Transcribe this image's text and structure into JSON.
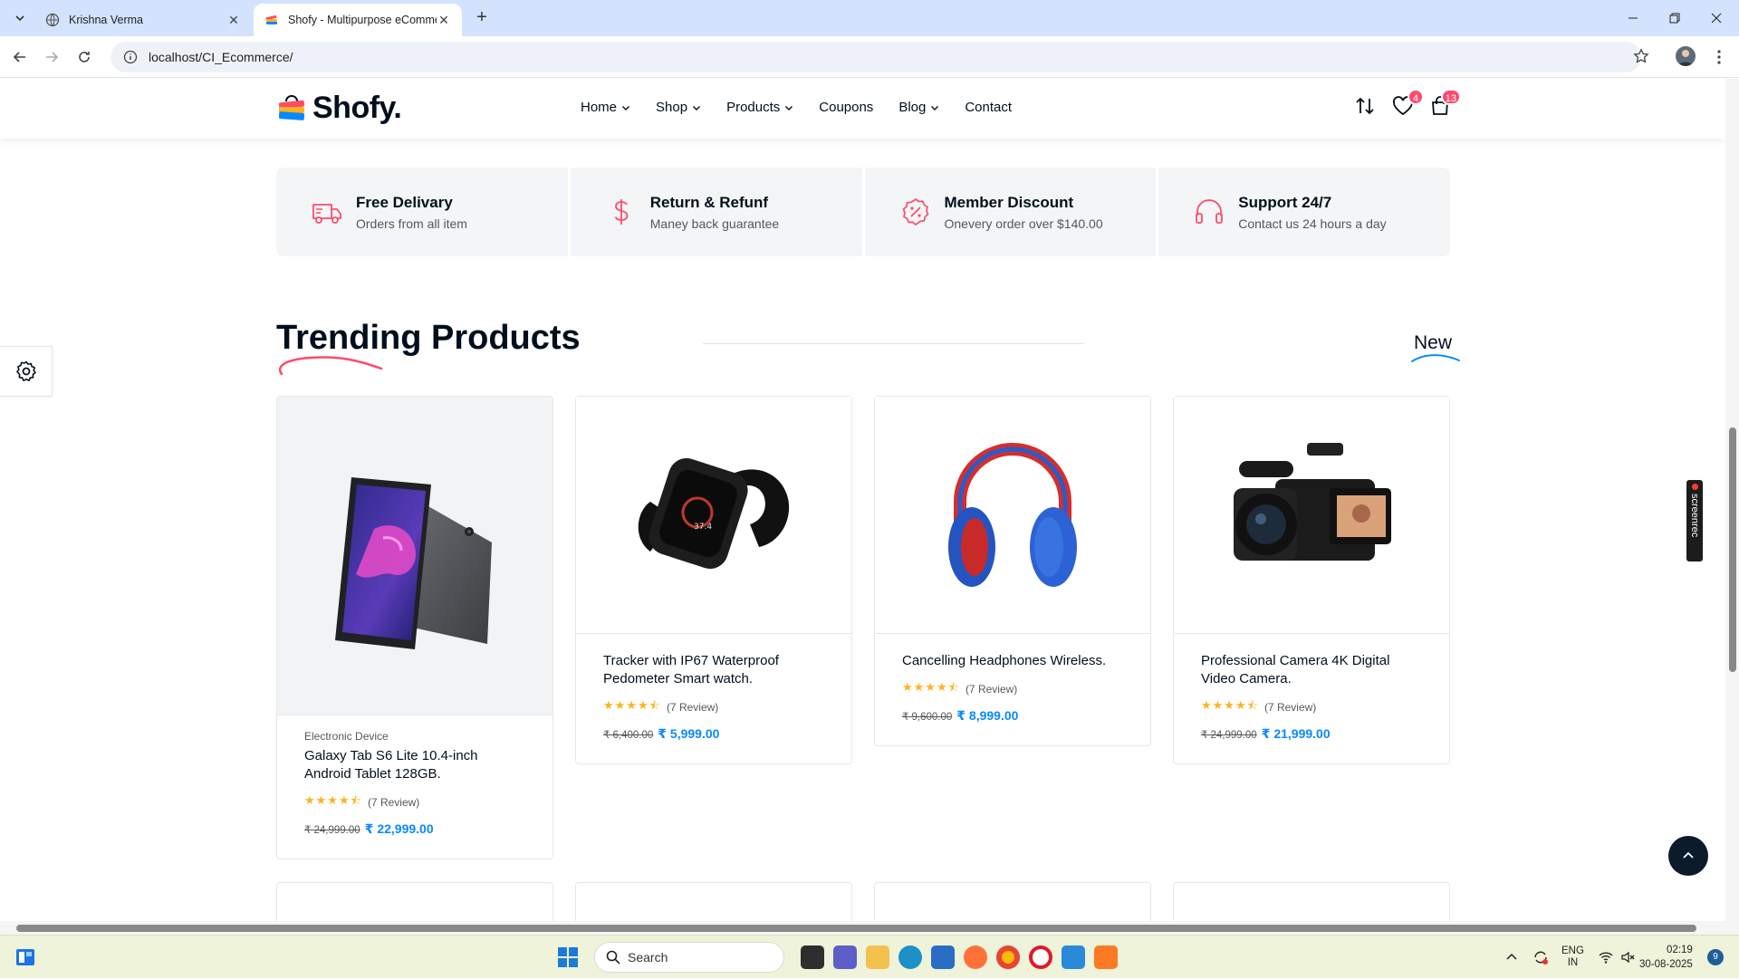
{
  "browser": {
    "tabs": [
      {
        "title": "Krishna Verma",
        "active": false
      },
      {
        "title": "Shofy - Multipurpose eCommerce",
        "active": true
      }
    ],
    "url": "localhost/CI_Ecommerce/"
  },
  "site": {
    "logo_text": "Shofy.",
    "nav": [
      {
        "label": "Home",
        "dropdown": true
      },
      {
        "label": "Shop",
        "dropdown": true
      },
      {
        "label": "Products",
        "dropdown": true
      },
      {
        "label": "Coupons",
        "dropdown": false
      },
      {
        "label": "Blog",
        "dropdown": true
      },
      {
        "label": "Contact",
        "dropdown": false
      }
    ],
    "wishlist_count": "4",
    "cart_count": "13",
    "accent_color": "#fd4b6b",
    "price_color": "#0989ff"
  },
  "features": [
    {
      "icon": "delivery-truck-icon",
      "title": "Free Delivary",
      "subtitle": "Orders from all item"
    },
    {
      "icon": "dollar-icon",
      "title": "Return & Refunf",
      "subtitle": "Maney back guarantee"
    },
    {
      "icon": "discount-badge-icon",
      "title": "Member Discount",
      "subtitle": "Onevery order over $140.00"
    },
    {
      "icon": "headphones-support-icon",
      "title": "Support 24/7",
      "subtitle": "Contact us 24 hours a day"
    }
  ],
  "trending": {
    "title": "Trending Products",
    "active_tab": "New",
    "products": [
      {
        "category": "Electronic Device",
        "name": "Galaxy Tab S6 Lite 10.4-inch Android Tablet 128GB.",
        "rating": 4.5,
        "reviews": "(7 Review)",
        "old_price": "₹ 24,999.00",
        "price": "₹ 22,999.00",
        "image": "tablet"
      },
      {
        "category": "",
        "name": "Tracker with IP67 Waterproof Pedometer Smart watch.",
        "rating": 4.5,
        "reviews": "(7 Review)",
        "old_price": "₹ 6,400.00",
        "price": "₹ 5,999.00",
        "image": "smartwatch"
      },
      {
        "category": "",
        "name": "Cancelling Headphones Wireless.",
        "rating": 4.5,
        "reviews": "(7 Review)",
        "old_price": "₹ 9,600.00",
        "price": "₹ 8,999.00",
        "image": "headphones"
      },
      {
        "category": "",
        "name": "Professional Camera 4K Digital Video Camera.",
        "rating": 4.5,
        "reviews": "(7 Review)",
        "old_price": "₹ 24,999.00",
        "price": "₹ 21,999.00",
        "image": "camera"
      }
    ]
  },
  "overlay": {
    "screenrec_label": "screenrec"
  },
  "taskbar": {
    "search_placeholder": "Search",
    "lang_line1": "ENG",
    "lang_line2": "IN",
    "time": "02:19",
    "date": "30-08-2025",
    "notification_count": "9"
  }
}
